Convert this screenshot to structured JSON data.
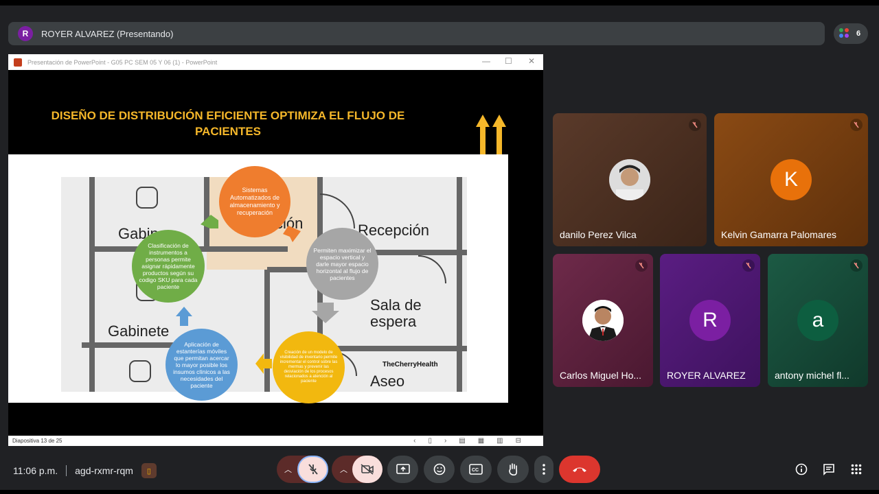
{
  "presenter": {
    "initial": "R",
    "label": "ROYER ALVAREZ (Presentando)"
  },
  "people_count": "6",
  "ppt_window": {
    "title": "Presentación de PowerPoint - G05 PC SEM 05 Y 06 (1) - PowerPoint",
    "slide_status": "Diapositiva 13 de 25"
  },
  "slide": {
    "title": "DISEÑO DE DISTRIBUCIÓN EFICIENTE OPTIMIZA EL FLUJO DE PACIENTES",
    "floorplan_labels": [
      "Gabin",
      "Recepción",
      "Sala de espera",
      "Gabinete",
      "Aseo",
      "ción"
    ],
    "brand": "TheCherryHealth",
    "circles": [
      {
        "text": "Sistemas Automatizados de almacenamiento y recuperación",
        "color": "#ef7d2e"
      },
      {
        "text": "Permiten maximizar el espacio vertical y darle mayor espacio horizontal al flujo de pacientes",
        "color": "#a6a6a6"
      },
      {
        "text": "Creación de un modelo de visibilidad de inventario permite incrementar el control sobre las mermas y prevenir las desviación de los procesos relacionados a atención al paciente",
        "color": "#f2b80f"
      },
      {
        "text": "Aplicación de estanterías móviles que permitan acercar lo mayor posible los insumos clínicos a las necesidades del paciente",
        "color": "#5b9bd5"
      },
      {
        "text": "Clasificación de instrumentos a personas permite asignar rápidamente productos según su codigo SKU para cada paciente",
        "color": "#70ad47"
      }
    ]
  },
  "participants": [
    {
      "name": "danilo Perez Vilca",
      "type": "photo"
    },
    {
      "name": "Kelvin Gamarra Palomares",
      "initial": "K"
    },
    {
      "name": "Carlos Miguel Ho...",
      "type": "photo"
    },
    {
      "name": "ROYER ALVAREZ",
      "initial": "R"
    },
    {
      "name": "antony michel fl...",
      "initial": "a"
    }
  ],
  "meeting": {
    "time": "11:06 p.m.",
    "code": "agd-rxmr-rqm"
  },
  "icons": {
    "mic": "mic-off-icon",
    "camera": "camera-off-icon",
    "present": "present-screen-icon",
    "emoji": "emoji-icon",
    "captions": "captions-icon",
    "hand": "raise-hand-icon",
    "more": "more-options-icon",
    "end_call": "end-call-icon",
    "info": "info-icon",
    "chat": "chat-icon",
    "activities": "apps-icon"
  }
}
